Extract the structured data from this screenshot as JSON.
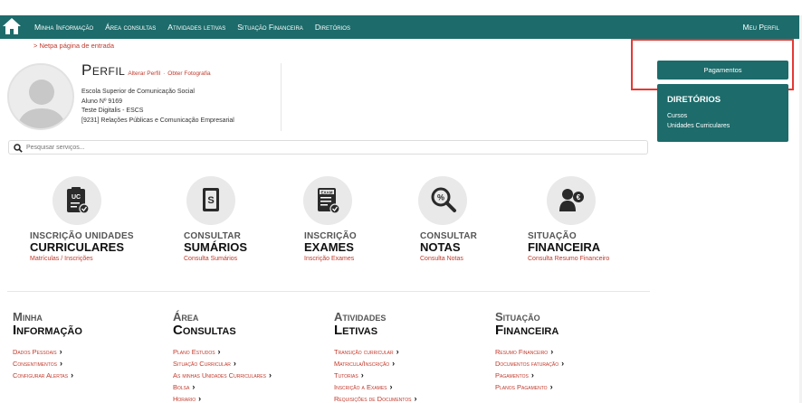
{
  "nav": {
    "items": [
      "Minha Informação",
      "Área consultas",
      "Atividades letivas",
      "Situação Financeira",
      "Diretórios"
    ],
    "right": "Meu Perfil"
  },
  "breadcrumb": "> Netpa página de entrada",
  "profile": {
    "title": "Perfil",
    "edit_link": "Alterar Perfil",
    "separator": "·",
    "photo_link": "Obter Fotografia",
    "lines": [
      "Escola Superior de Comunicação Social",
      "Aluno Nº 9169",
      "Teste Digitalis - ESCS",
      "[9231] Relações Públicas e Comunicação Empresarial"
    ]
  },
  "search": {
    "placeholder": "Pesquisar serviços..."
  },
  "services": [
    {
      "icon": "uc-clipboard-icon",
      "line1": "INSCRIÇÃO UNIDADES",
      "line2": "CURRICULARES",
      "link": "Matrículas / Inscrições"
    },
    {
      "icon": "document-s-icon",
      "line1": "CONSULTAR",
      "line2": "SUMÁRIOS",
      "link": "Consulta Sumários"
    },
    {
      "icon": "exam-icon",
      "line1": "INSCRIÇÃO",
      "line2": "EXAMES",
      "link": "Inscrição Exames"
    },
    {
      "icon": "magnifier-grade-icon",
      "line1": "CONSULTAR",
      "line2": "NOTAS",
      "link": "Consulta Notas"
    },
    {
      "icon": "person-euro-icon",
      "line1": "SITUAÇÃO",
      "line2": "FINANCEIRA",
      "link": "Consulta Resumo Financeiro"
    }
  ],
  "columns": [
    {
      "h1": "Minha",
      "h2": "Informação",
      "items": [
        "Dados Pessoais",
        "Consentimentos",
        "Configurar Alertas"
      ]
    },
    {
      "h1": "Área",
      "h2": "Consultas",
      "items": [
        "Plano Estudos",
        "Situação Curricular",
        "As minhas Unidades Curriculares",
        "Bolsa",
        "Horario"
      ]
    },
    {
      "h1": "Atividades",
      "h2": "Letivas",
      "items": [
        "Transição curricular",
        "Matricula/Inscrição",
        "Tutorias",
        "Inscrição a Exames",
        "Requisições de Documentos"
      ]
    },
    {
      "h1": "Situação",
      "h2": "Financeira",
      "items": [
        "Resumo Financeiro",
        "Documentos faturação",
        "Pagamentos",
        "Planos Pagamento"
      ]
    }
  ],
  "right_panel": {
    "payments": "Pagamentos",
    "directories_title": "DIRETÓRIOS",
    "directories": [
      "Cursos",
      "Unidades Curriculares"
    ]
  },
  "colors": {
    "teal": "#1d6b6b",
    "link": "#c0392b",
    "highlight": "#e53935"
  }
}
